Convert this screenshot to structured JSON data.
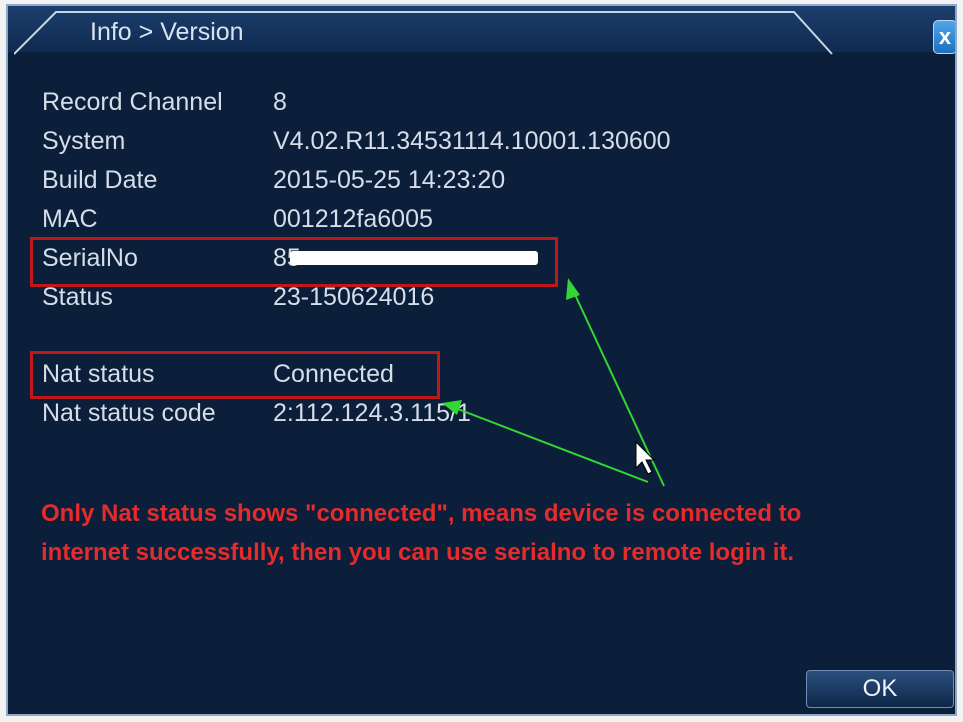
{
  "window": {
    "breadcrumb": "Info > Version",
    "close_label": "x"
  },
  "info": {
    "record_channel": {
      "label": "Record Channel",
      "value": "8"
    },
    "system": {
      "label": "System",
      "value": "V4.02.R11.34531114.10001.130600"
    },
    "build_date": {
      "label": "Build Date",
      "value": "2015-05-25 14:23:20"
    },
    "mac": {
      "label": "MAC",
      "value": "001212fa6005"
    },
    "serial_no": {
      "label": "SerialNo",
      "value": "85"
    },
    "status": {
      "label": "Status",
      "value": "23-150624016"
    },
    "nat_status": {
      "label": "Nat status",
      "value": "Connected"
    },
    "nat_status_code": {
      "label": "Nat status code",
      "value": "2:112.124.3.115/1"
    }
  },
  "annotation": {
    "line1": "Only Nat status shows \"connected\", means device is connected to",
    "line2": "internet successfully, then you can use serialno to remote login it."
  },
  "buttons": {
    "ok_label": "OK"
  },
  "colors": {
    "window_bg": "#0b1f3b",
    "text": "#d5dde8",
    "highlight_box": "#c01818",
    "annotation_text": "#e52b2b",
    "arrow": "#33d633"
  }
}
